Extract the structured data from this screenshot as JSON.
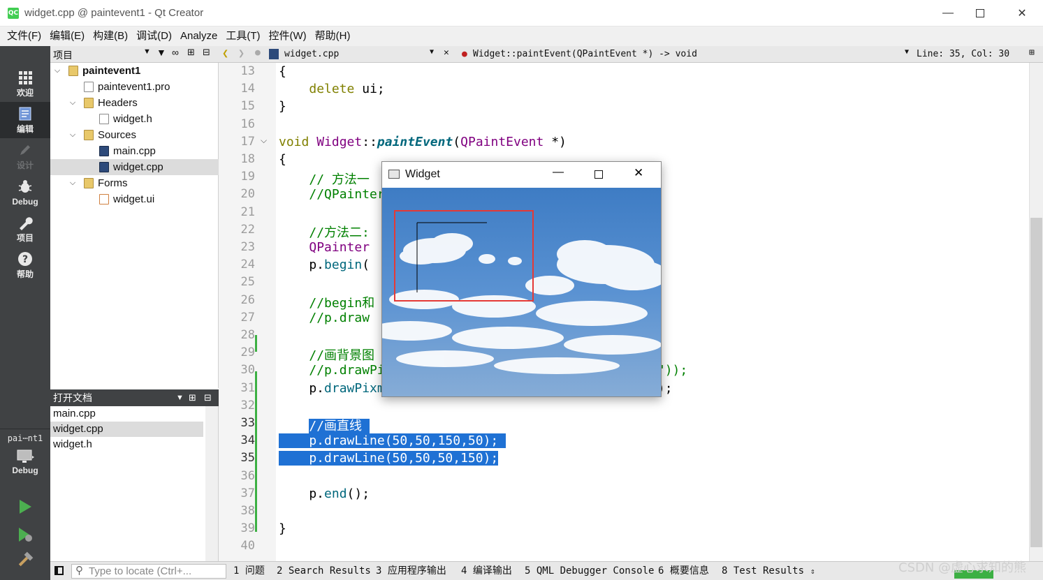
{
  "window": {
    "title": "widget.cpp @ paintevent1 - Qt Creator",
    "app_icon": "QC"
  },
  "menu": [
    "文件(F)",
    "编辑(E)",
    "构建(B)",
    "调试(D)",
    "Analyze",
    "工具(T)",
    "控件(W)",
    "帮助(H)"
  ],
  "modes": [
    {
      "label": "欢迎",
      "icon": "grid-icon"
    },
    {
      "label": "编辑",
      "icon": "edit-document-icon",
      "active": true
    },
    {
      "label": "设计",
      "icon": "pencil-icon",
      "disabled": true
    },
    {
      "label": "Debug",
      "icon": "bug-icon"
    },
    {
      "label": "项目",
      "icon": "wrench-icon"
    },
    {
      "label": "帮助",
      "icon": "help-icon"
    }
  ],
  "kit": {
    "project": "pai⋯nt1",
    "build": "Debug"
  },
  "project_panel": {
    "title": "项目",
    "tree": [
      {
        "label": "paintevent1",
        "level": 0,
        "arrow": "expanded",
        "bold": true,
        "icon": "project-folder-icon"
      },
      {
        "label": "paintevent1.pro",
        "level": 1,
        "icon": "pro-file-icon"
      },
      {
        "label": "Headers",
        "level": 1,
        "arrow": "expanded",
        "icon": "folder-h-icon"
      },
      {
        "label": "widget.h",
        "level": 2,
        "icon": "header-file-icon"
      },
      {
        "label": "Sources",
        "level": 1,
        "arrow": "expanded",
        "icon": "folder-cpp-icon"
      },
      {
        "label": "main.cpp",
        "level": 2,
        "icon": "cpp-file-icon"
      },
      {
        "label": "widget.cpp",
        "level": 2,
        "icon": "cpp-file-icon",
        "selected": true
      },
      {
        "label": "Forms",
        "level": 1,
        "arrow": "expanded",
        "icon": "folder-forms-icon"
      },
      {
        "label": "widget.ui",
        "level": 2,
        "icon": "ui-file-icon"
      }
    ]
  },
  "open_docs": {
    "title": "打开文档",
    "items": [
      {
        "label": "main.cpp"
      },
      {
        "label": "widget.cpp",
        "selected": true
      },
      {
        "label": "widget.h"
      }
    ]
  },
  "editor_toolbar": {
    "file": "widget.cpp",
    "symbol": "Widget::paintEvent(QPaintEvent *) -> void",
    "position": "Line: 35, Col: 30"
  },
  "code_lines": [
    {
      "n": "13",
      "html": "{"
    },
    {
      "n": "14",
      "html": "    <span class='kw'>delete</span> ui;"
    },
    {
      "n": "15",
      "html": "}"
    },
    {
      "n": "16",
      "html": ""
    },
    {
      "n": "17",
      "html": "<span class='kw'>void</span> <span class='ty'>Widget</span>::<span class='fn'>paintEvent</span>(<span class='ty'>QPaintEvent</span> *)"
    },
    {
      "n": "18",
      "html": "{"
    },
    {
      "n": "19",
      "html": "    <span class='cm'>// 方法一</span>"
    },
    {
      "n": "20",
      "html": "    <span class='cm'>//QPainter</span>"
    },
    {
      "n": "21",
      "html": ""
    },
    {
      "n": "22",
      "html": "    <span class='cm'>//方法二:</span>"
    },
    {
      "n": "23",
      "html": "    <span class='ty'>QPainter</span>"
    },
    {
      "n": "24",
      "html": "    p.<span class='mt'>begin</span>("
    },
    {
      "n": "25",
      "html": ""
    },
    {
      "n": "26",
      "html": "    <span class='cm'>//begin和</span>"
    },
    {
      "n": "27",
      "html": "    <span class='cm'>//p.draw</span>"
    },
    {
      "n": "28",
      "html": ""
    },
    {
      "n": "29",
      "html": "    <span class='cm'>//画背景图</span>"
    },
    {
      "n": "30",
      "html": "    <span class='cm'>//p.drawPixmap(rect(),QPixmap(\"../tuoian/5.jpg\"));</span>"
    },
    {
      "n": "31",
      "html": "    p.<span class='mt'>drawPixmap</span>(<span class='mt'>rect</span>(),<span class='ty'>QPixmap</span>(<span class='str'>\"../tuoian/5.jpg\"</span>));"
    },
    {
      "n": "32",
      "html": ""
    },
    {
      "n": "33",
      "html": "    <span class='hl'>//画直线 </span>"
    },
    {
      "n": "34",
      "html": "<span class='hl'>    p.drawLine(50,50,150,50); </span>"
    },
    {
      "n": "35",
      "html": "<span class='hl'>    p.drawLine(50,50,50,150);</span>"
    },
    {
      "n": "36",
      "html": ""
    },
    {
      "n": "37",
      "html": "    p.<span class='mt'>end</span>();"
    },
    {
      "n": "38",
      "html": ""
    },
    {
      "n": "39",
      "html": "}"
    },
    {
      "n": "40",
      "html": ""
    }
  ],
  "widget_window": {
    "title": "Widget"
  },
  "bottom": {
    "locator_placeholder": "Type to locate (Ctrl+...",
    "tabs": [
      "1 问题",
      "2 Search Results",
      "3 应用程序输出",
      "4 编译输出",
      "5 QML Debugger Console",
      "6 概要信息",
      "8 Test Results"
    ]
  },
  "watermark": "CSDN @虚心求知的熊",
  "colors": {
    "accent_selection": "#1f71d4",
    "mode_bar": "#404244",
    "red_box": "#e53935"
  }
}
